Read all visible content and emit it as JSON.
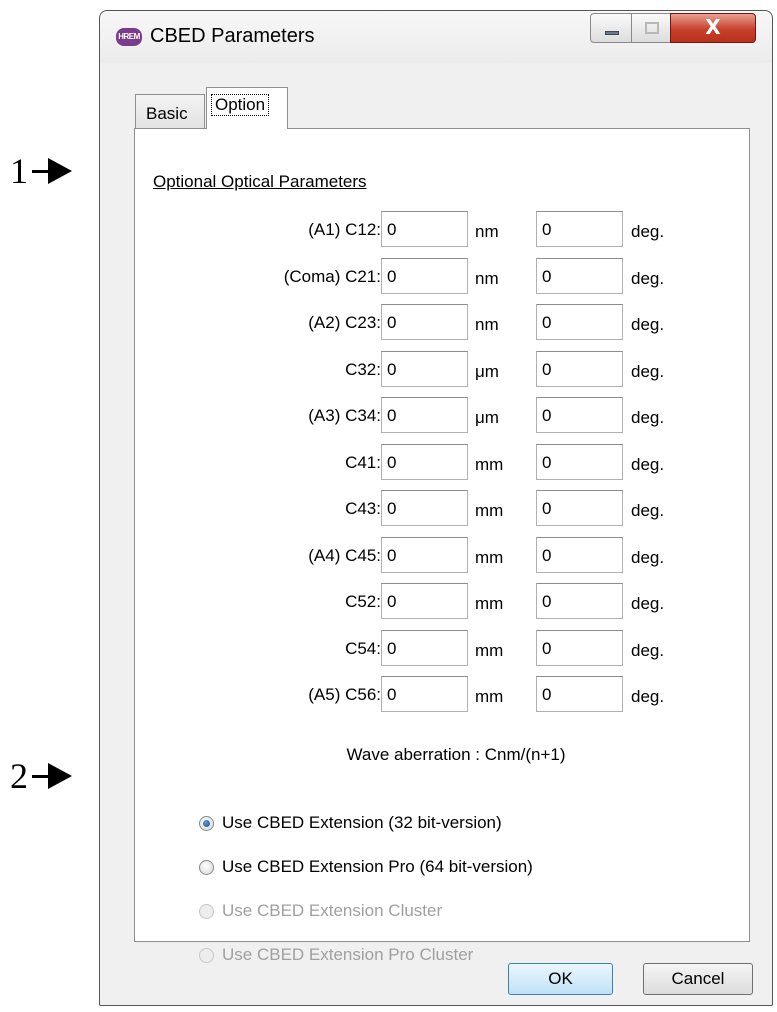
{
  "annotations": [
    "1",
    "2"
  ],
  "window": {
    "title": "CBED Parameters",
    "app_icon_text": "HREM",
    "close_glyph": "X"
  },
  "tabs": [
    {
      "label": "Basic",
      "selected": false
    },
    {
      "label": "Option",
      "selected": true
    }
  ],
  "section_title": "Optional Optical Parameters",
  "rows": [
    {
      "label": "(A1) C12:",
      "value1": "0",
      "unit": "nm",
      "value2": "0",
      "unit2": "deg."
    },
    {
      "label": "(Coma) C21:",
      "value1": "0",
      "unit": "nm",
      "value2": "0",
      "unit2": "deg."
    },
    {
      "label": "(A2) C23:",
      "value1": "0",
      "unit": "nm",
      "value2": "0",
      "unit2": "deg."
    },
    {
      "label": "C32:",
      "value1": "0",
      "unit": "μm",
      "value2": "0",
      "unit2": "deg."
    },
    {
      "label": "(A3) C34:",
      "value1": "0",
      "unit": "μm",
      "value2": "0",
      "unit2": "deg."
    },
    {
      "label": "C41:",
      "value1": "0",
      "unit": "mm",
      "value2": "0",
      "unit2": "deg."
    },
    {
      "label": "C43:",
      "value1": "0",
      "unit": "mm",
      "value2": "0",
      "unit2": "deg."
    },
    {
      "label": "(A4) C45:",
      "value1": "0",
      "unit": "mm",
      "value2": "0",
      "unit2": "deg."
    },
    {
      "label": "C52:",
      "value1": "0",
      "unit": "mm",
      "value2": "0",
      "unit2": "deg."
    },
    {
      "label": "C54:",
      "value1": "0",
      "unit": "mm",
      "value2": "0",
      "unit2": "deg."
    },
    {
      "label": "(A5) C56:",
      "value1": "0",
      "unit": "mm",
      "value2": "0",
      "unit2": "deg."
    }
  ],
  "formula": "Wave aberration : Cnm/(n+1)",
  "radios": [
    {
      "label": "Use CBED Extension (32 bit-version)",
      "checked": true,
      "enabled": true
    },
    {
      "label": "Use CBED Extension Pro (64 bit-version)",
      "checked": false,
      "enabled": true
    },
    {
      "label": "Use CBED Extension Cluster",
      "checked": false,
      "enabled": false
    },
    {
      "label": "Use CBED Extension Pro Cluster",
      "checked": false,
      "enabled": false
    }
  ],
  "buttons": {
    "ok": "OK",
    "cancel": "Cancel"
  }
}
